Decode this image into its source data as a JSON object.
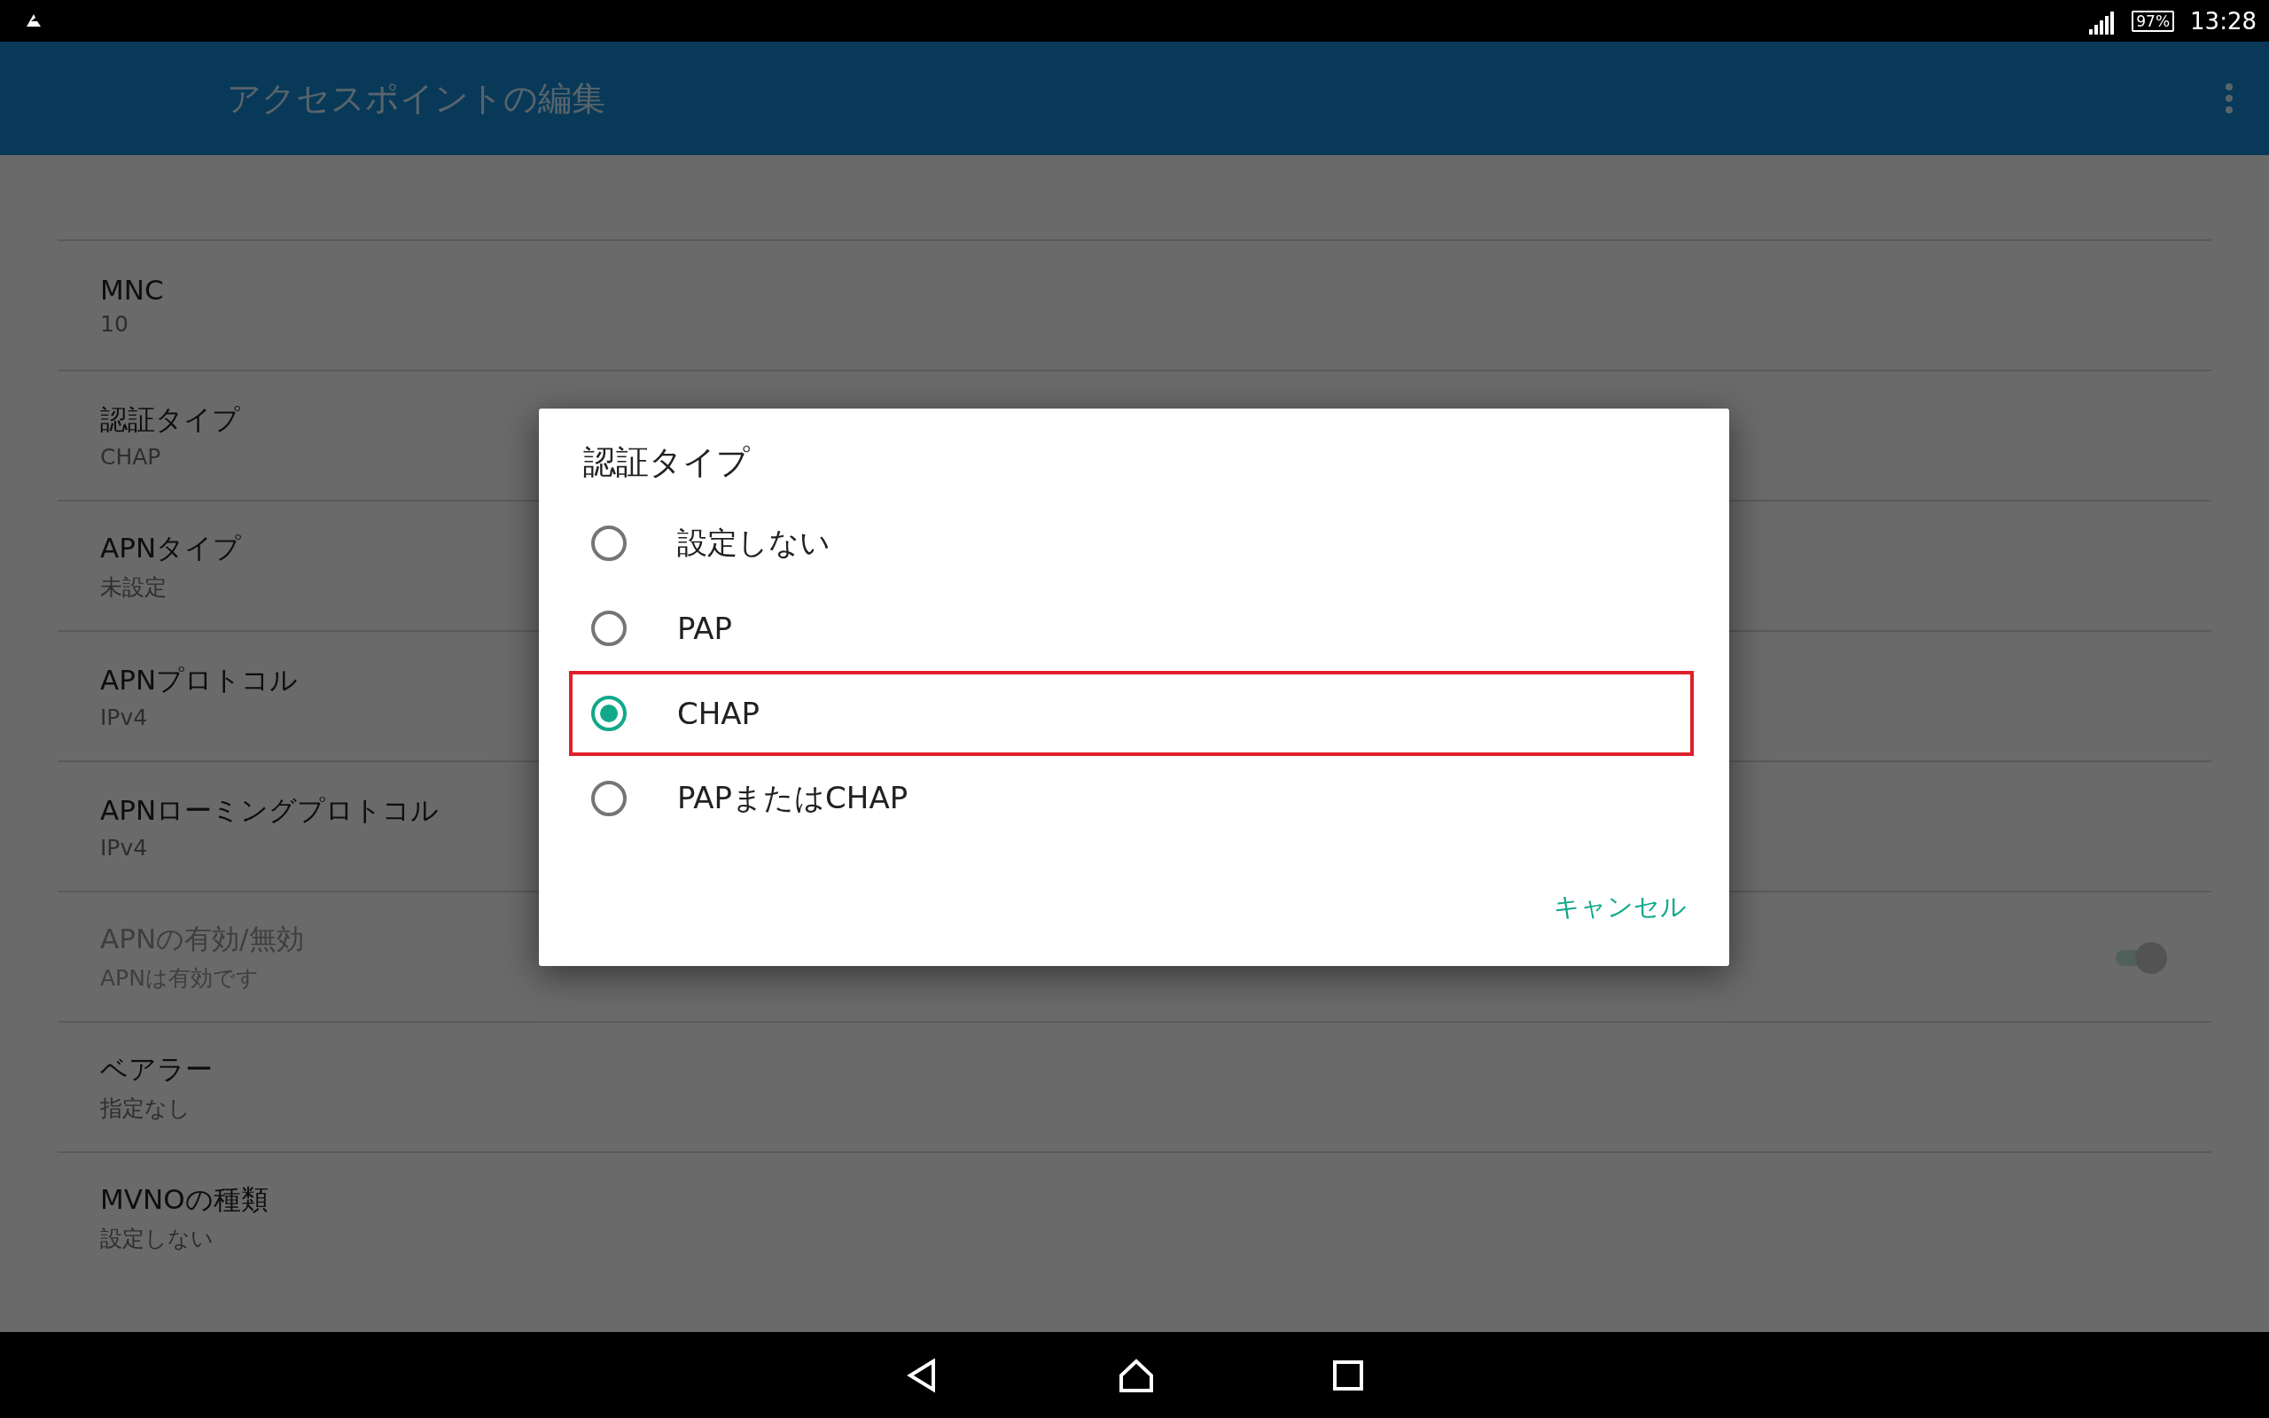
{
  "status_bar": {
    "battery": "97%",
    "time": "13:28"
  },
  "app_bar": {
    "title": "アクセスポイントの編集"
  },
  "settings": [
    {
      "kind": "text",
      "label": "MNC",
      "summary": "10",
      "disabled": false
    },
    {
      "kind": "text",
      "label": "認証タイプ",
      "summary": "CHAP",
      "disabled": false
    },
    {
      "kind": "text",
      "label": "APNタイプ",
      "summary": "未設定",
      "disabled": false
    },
    {
      "kind": "text",
      "label": "APNプロトコル",
      "summary": "IPv4",
      "disabled": false
    },
    {
      "kind": "text",
      "label": "APNローミングプロトコル",
      "summary": "IPv4",
      "disabled": false
    },
    {
      "kind": "switch",
      "label": "APNの有効/無効",
      "summary": "APNは有効です",
      "disabled": true,
      "on": true
    },
    {
      "kind": "text",
      "label": "ベアラー",
      "summary": "指定なし",
      "disabled": false
    },
    {
      "kind": "text",
      "label": "MVNOの種類",
      "summary": "設定しない",
      "disabled": false
    }
  ],
  "dialog": {
    "title": "認証タイプ",
    "options": [
      {
        "label": "設定しない",
        "selected": false,
        "highlighted": false
      },
      {
        "label": "PAP",
        "selected": false,
        "highlighted": false
      },
      {
        "label": "CHAP",
        "selected": true,
        "highlighted": true
      },
      {
        "label": "PAPまたはCHAP",
        "selected": false,
        "highlighted": false
      }
    ],
    "cancel": "キャンセル"
  }
}
